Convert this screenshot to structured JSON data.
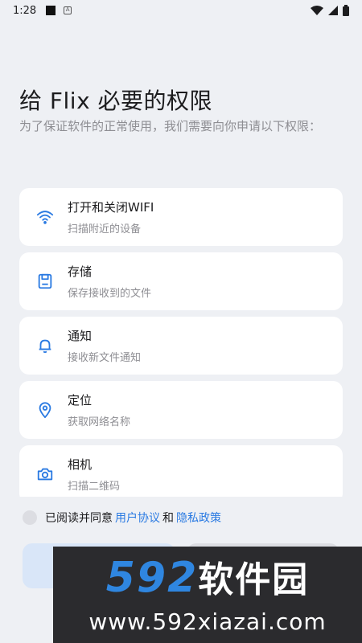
{
  "status": {
    "time": "1:28"
  },
  "header": {
    "title": "给 Flix 必要的权限",
    "subtitle": "为了保证软件的正常使用，我们需要向你申请以下权限："
  },
  "permissions": [
    {
      "icon": "wifi-icon",
      "title": "打开和关闭WIFI",
      "desc": "扫描附近的设备"
    },
    {
      "icon": "storage-icon",
      "title": "存储",
      "desc": "保存接收到的文件"
    },
    {
      "icon": "bell-icon",
      "title": "通知",
      "desc": "接收新文件通知"
    },
    {
      "icon": "location-pin-icon",
      "title": "定位",
      "desc": "获取网络名称"
    },
    {
      "icon": "camera-icon",
      "title": "相机",
      "desc": "扫描二维码"
    }
  ],
  "agreement": {
    "prefix": "已阅读并同意",
    "user_agreement": "用户协议",
    "and": "和",
    "privacy_policy": "隐私政策"
  },
  "watermark": {
    "number": "592",
    "brand": "软件园",
    "url": "www.592xiazai.com"
  },
  "colors": {
    "accent": "#2a7ae2",
    "background": "#eef0f4",
    "card": "#ffffff"
  }
}
